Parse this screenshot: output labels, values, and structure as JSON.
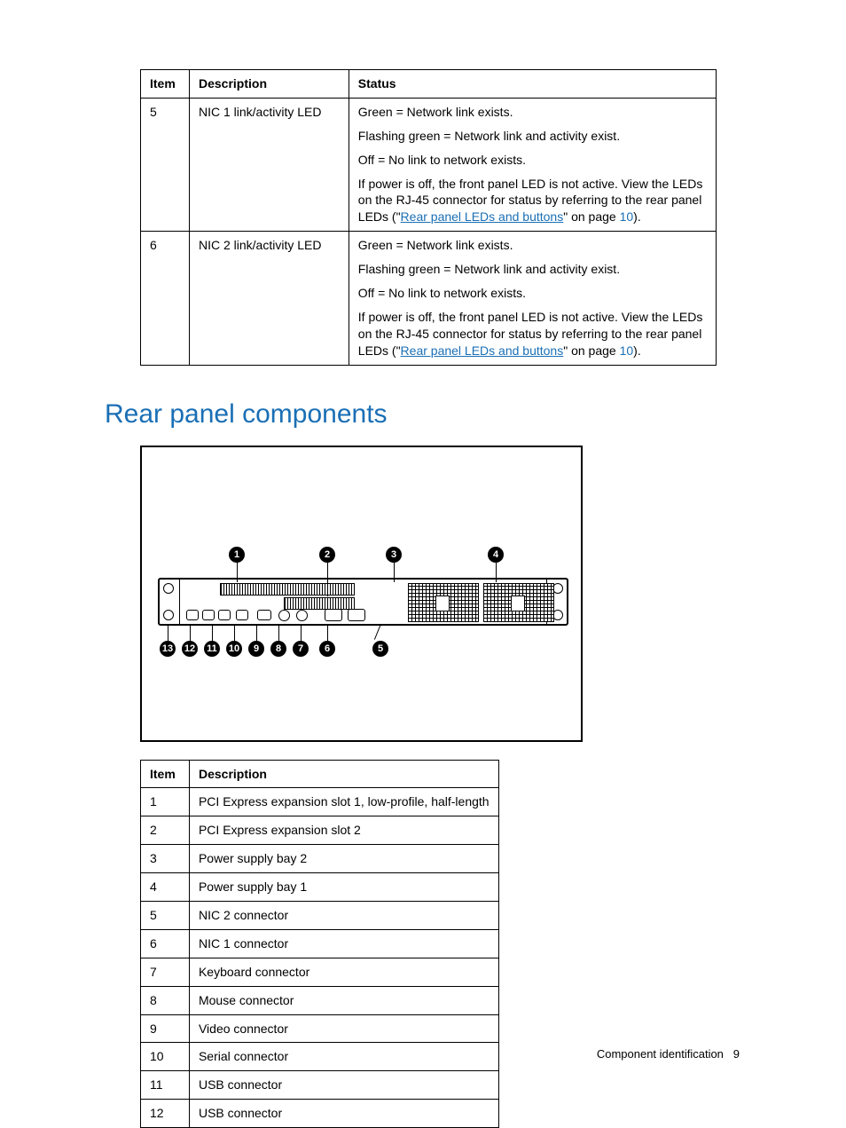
{
  "table1": {
    "headers": {
      "item": "Item",
      "description": "Description",
      "status": "Status"
    },
    "rows": [
      {
        "item": "5",
        "description": "NIC 1 link/activity LED",
        "status": {
          "l1": "Green = Network link exists.",
          "l2": "Flashing green = Network link and activity exist.",
          "l3": "Off = No link to network exists.",
          "l4a": "If power is off, the front panel LED is not active. View the LEDs on the RJ-45 connector for status by referring to the rear panel LEDs (\"",
          "link": "Rear panel LEDs and buttons",
          "l4b": "\" on page ",
          "page": "10",
          "l4c": ")."
        }
      },
      {
        "item": "6",
        "description": "NIC 2 link/activity LED",
        "status": {
          "l1": "Green = Network link exists.",
          "l2": "Flashing green = Network link and activity exist.",
          "l3": "Off = No link to network exists.",
          "l4a": "If power is off, the front panel LED is not active. View the LEDs on the RJ-45 connector for status by referring to the rear panel LEDs (\"",
          "link": "Rear panel LEDs and buttons",
          "l4b": "\" on page ",
          "page": "10",
          "l4c": ")."
        }
      }
    ]
  },
  "heading": "Rear panel components",
  "callouts": {
    "1": "1",
    "2": "2",
    "3": "3",
    "4": "4",
    "5": "5",
    "6": "6",
    "7": "7",
    "8": "8",
    "9": "9",
    "10": "10",
    "11": "11",
    "12": "12",
    "13": "13"
  },
  "table2": {
    "headers": {
      "item": "Item",
      "description": "Description"
    },
    "rows": [
      {
        "item": "1",
        "description": "PCI Express expansion slot 1, low-profile, half-length"
      },
      {
        "item": "2",
        "description": "PCI Express expansion slot 2"
      },
      {
        "item": "3",
        "description": "Power supply bay 2"
      },
      {
        "item": "4",
        "description": "Power supply bay 1"
      },
      {
        "item": "5",
        "description": "NIC 2 connector"
      },
      {
        "item": "6",
        "description": "NIC 1 connector"
      },
      {
        "item": "7",
        "description": "Keyboard connector"
      },
      {
        "item": "8",
        "description": "Mouse connector"
      },
      {
        "item": "9",
        "description": "Video connector"
      },
      {
        "item": "10",
        "description": "Serial connector"
      },
      {
        "item": "11",
        "description": "USB connector"
      },
      {
        "item": "12",
        "description": "USB connector"
      }
    ]
  },
  "footer": {
    "section": "Component identification",
    "page": "9"
  }
}
